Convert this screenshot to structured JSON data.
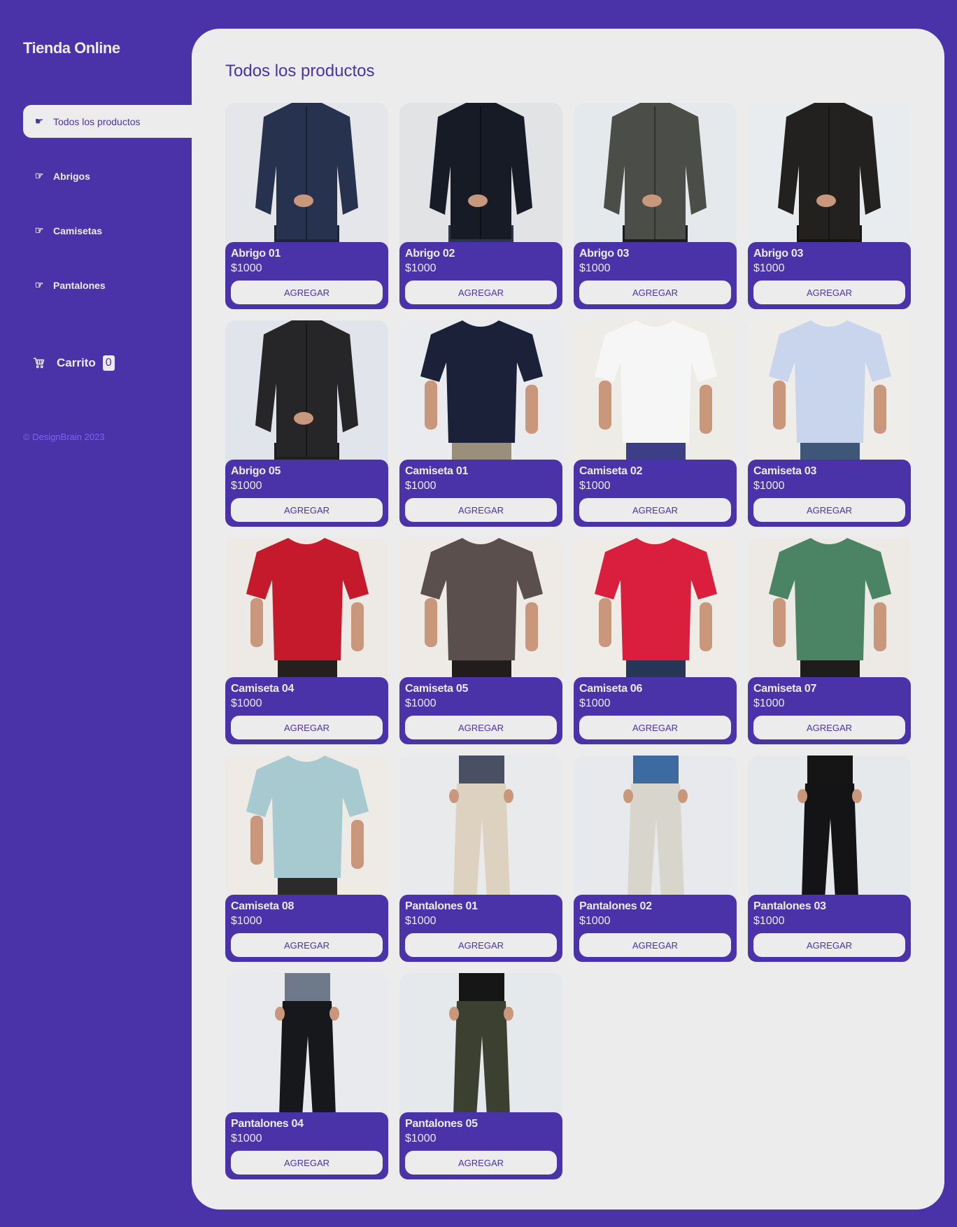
{
  "brand": {
    "title": "Tienda Online",
    "accent": "#4a33a9",
    "surface": "#ececec"
  },
  "sidebar": {
    "items": [
      {
        "label": "Todos los productos",
        "icon": "pointing-hand-filled-icon",
        "active": true
      },
      {
        "label": "Abrigos",
        "icon": "pointing-hand-outline-icon",
        "active": false
      },
      {
        "label": "Camisetas",
        "icon": "pointing-hand-outline-icon",
        "active": false
      },
      {
        "label": "Pantalones",
        "icon": "pointing-hand-outline-icon",
        "active": false
      }
    ],
    "cart": {
      "label": "Carrito",
      "count": "0",
      "icon": "cart-icon"
    },
    "footer": "© DesignBrain 2023"
  },
  "main": {
    "title": "Todos los productos"
  },
  "products": [
    {
      "name": "Abrigo 01",
      "price": "$1000",
      "button": "AGREGAR",
      "garment": "jacket",
      "color": "#27324f",
      "bottom": "#1d2638",
      "bg": "#e4e6ea"
    },
    {
      "name": "Abrigo 02",
      "price": "$1000",
      "button": "AGREGAR",
      "garment": "jacket",
      "color": "#171b26",
      "bottom": "#2a3550",
      "bg": "#e2e3e5"
    },
    {
      "name": "Abrigo 03",
      "price": "$1000",
      "button": "AGREGAR",
      "garment": "jacket",
      "color": "#4b4d48",
      "bottom": "#1b1c1f",
      "bg": "#e6e9eb"
    },
    {
      "name": "Abrigo 03",
      "price": "$1000",
      "button": "AGREGAR",
      "garment": "jacket",
      "color": "#222120",
      "bottom": "#151515",
      "bg": "#e9ecef"
    },
    {
      "name": "Abrigo 05",
      "price": "$1000",
      "button": "AGREGAR",
      "garment": "jacket",
      "color": "#262628",
      "bottom": "#1e1e20",
      "bg": "#e1e4ea"
    },
    {
      "name": "Camiseta 01",
      "price": "$1000",
      "button": "AGREGAR",
      "garment": "tshirt",
      "color": "#1a2138",
      "bottom": "#9a8f7a",
      "bg": "#e9ebef"
    },
    {
      "name": "Camiseta 02",
      "price": "$1000",
      "button": "AGREGAR",
      "garment": "tshirt",
      "color": "#f6f6f6",
      "bottom": "#3d3f86",
      "bg": "#eeece6"
    },
    {
      "name": "Camiseta 03",
      "price": "$1000",
      "button": "AGREGAR",
      "garment": "tshirt",
      "color": "#c9d5ec",
      "bottom": "#3e5678",
      "bg": "#efede9"
    },
    {
      "name": "Camiseta 04",
      "price": "$1000",
      "button": "AGREGAR",
      "garment": "tshirt",
      "color": "#c41a2b",
      "bottom": "#25201e",
      "bg": "#ede9e4"
    },
    {
      "name": "Camiseta 05",
      "price": "$1000",
      "button": "AGREGAR",
      "garment": "tshirt",
      "color": "#5a4f4c",
      "bottom": "#221d1c",
      "bg": "#eeeae5"
    },
    {
      "name": "Camiseta 06",
      "price": "$1000",
      "button": "AGREGAR",
      "garment": "tshirt",
      "color": "#d91f3d",
      "bottom": "#253657",
      "bg": "#efebe6"
    },
    {
      "name": "Camiseta 07",
      "price": "$1000",
      "button": "AGREGAR",
      "garment": "tshirt",
      "color": "#4b8465",
      "bottom": "#1f1d1c",
      "bg": "#ede9e4"
    },
    {
      "name": "Camiseta 08",
      "price": "$1000",
      "button": "AGREGAR",
      "garment": "tshirt",
      "color": "#a7cad0",
      "bottom": "#2c2a2a",
      "bg": "#eeeae6"
    },
    {
      "name": "Pantalones 01",
      "price": "$1000",
      "button": "AGREGAR",
      "garment": "pants",
      "color": "#ddd2c0",
      "bottom": "#4a5064",
      "bg": "#e9eaeb"
    },
    {
      "name": "Pantalones 02",
      "price": "$1000",
      "button": "AGREGAR",
      "garment": "pants",
      "color": "#d8d6cc",
      "bottom": "#3d6aa0",
      "bg": "#e7e9ec"
    },
    {
      "name": "Pantalones 03",
      "price": "$1000",
      "button": "AGREGAR",
      "garment": "pants",
      "color": "#141416",
      "bottom": "#151515",
      "bg": "#e6e9ec"
    },
    {
      "name": "Pantalones 04",
      "price": "$1000",
      "button": "AGREGAR",
      "garment": "pants",
      "color": "#17181b",
      "bottom": "#6e7a8a",
      "bg": "#e8eaed"
    },
    {
      "name": "Pantalones 05",
      "price": "$1000",
      "button": "AGREGAR",
      "garment": "pants",
      "color": "#3c4030",
      "bottom": "#161616",
      "bg": "#e6e9eb"
    }
  ]
}
